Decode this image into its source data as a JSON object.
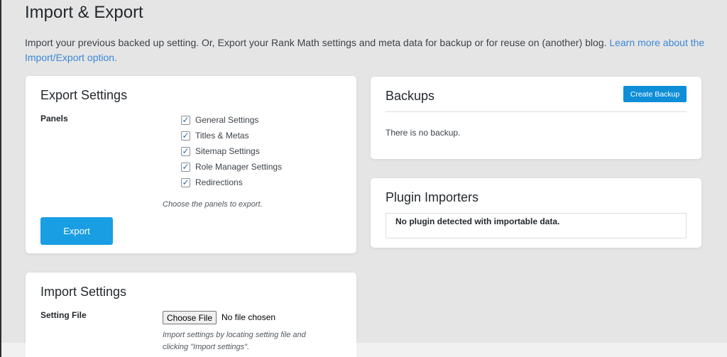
{
  "page": {
    "title": "Import & Export",
    "intro_text": "Import your previous backed up setting. Or, Export your Rank Math settings and meta data for backup or for reuse on (another) blog.",
    "intro_link": "Learn more about the Import/Export option."
  },
  "export": {
    "title": "Export Settings",
    "panels_label": "Panels",
    "panels": [
      {
        "label": "General Settings",
        "checked": true
      },
      {
        "label": "Titles & Metas",
        "checked": true
      },
      {
        "label": "Sitemap Settings",
        "checked": true
      },
      {
        "label": "Role Manager Settings",
        "checked": true
      },
      {
        "label": "Redirections",
        "checked": true
      }
    ],
    "hint": "Choose the panels to export.",
    "button_label": "Export"
  },
  "backups": {
    "title": "Backups",
    "create_button": "Create Backup",
    "empty_message": "There is no backup."
  },
  "importers": {
    "title": "Plugin Importers",
    "message": "No plugin detected with importable data."
  },
  "import": {
    "title": "Import Settings",
    "setting_file_label": "Setting File",
    "choose_file_label": "Choose File",
    "no_file_text": "No file chosen",
    "hint": "Import settings by locating setting file and clicking \"Import settings\"."
  },
  "colors": {
    "primary_button": "#199ee3",
    "link": "#3c87d8",
    "background": "#e5e5e5"
  },
  "icons": {
    "checkbox_checked": "check-icon"
  }
}
